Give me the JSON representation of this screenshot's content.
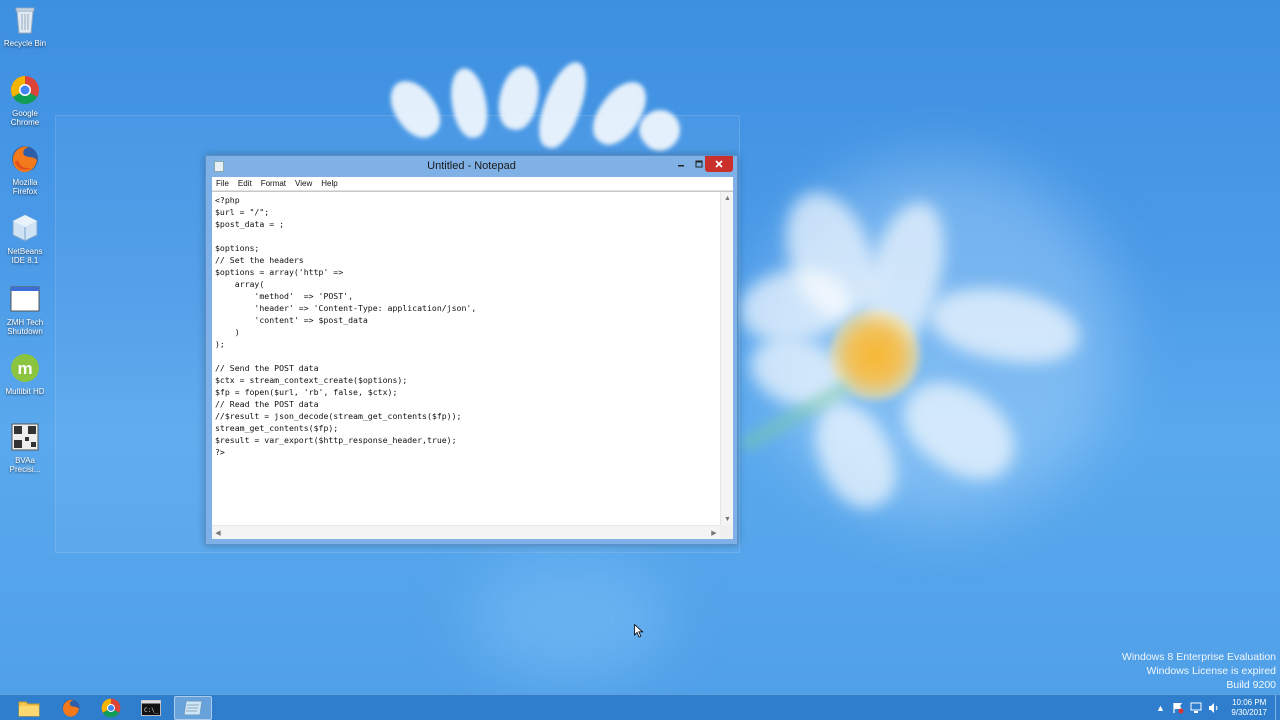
{
  "desktop": {
    "icons": [
      {
        "label": "Recycle Bin",
        "icon": "recycle-bin-icon"
      },
      {
        "label": "Google Chrome",
        "icon": "chrome-icon"
      },
      {
        "label": "Mozilla Firefox",
        "icon": "firefox-icon"
      },
      {
        "label": "NetBeans IDE 8.1",
        "icon": "netbeans-icon"
      },
      {
        "label": "ZMH Tech Shutdown",
        "icon": "window-app-icon"
      },
      {
        "label": "Multibit HD",
        "icon": "multibit-icon"
      },
      {
        "label": "BVAa Precisi...",
        "icon": "qr-app-icon"
      }
    ]
  },
  "notepad": {
    "title": "Untitled - Notepad",
    "menu": [
      "File",
      "Edit",
      "Format",
      "View",
      "Help"
    ],
    "content": "<?php\n$url = \"/\";\n$post_data = ;\n\n$options;\n// Set the headers\n$options = array('http' =>\n    array(\n        'method'  => 'POST',\n        'header' => 'Content-Type: application/json',\n        'content' => $post_data\n    )\n);\n\n// Send the POST data\n$ctx = stream_context_create($options);\n$fp = fopen($url, 'rb', false, $ctx);\n// Read the POST data\n//$result = json_decode(stream_get_contents($fp));\nstream_get_contents($fp);\n$result = var_export($http_response_header,true);\n?>"
  },
  "watermark": {
    "line1": "Windows 8 Enterprise Evaluation",
    "line2": "Windows License is expired",
    "line3": "Build 9200"
  },
  "taskbar": {
    "apps": [
      "file-explorer-icon",
      "firefox-icon",
      "chrome-icon",
      "command-prompt-icon",
      "notepad-icon"
    ],
    "active": "notepad-icon"
  },
  "tray": {
    "time": "10:06 PM",
    "date": "9/30/2017"
  },
  "colors": {
    "accent": "#4a9ae8",
    "close_button": "#c9302c",
    "taskbar": "#2878c8"
  }
}
